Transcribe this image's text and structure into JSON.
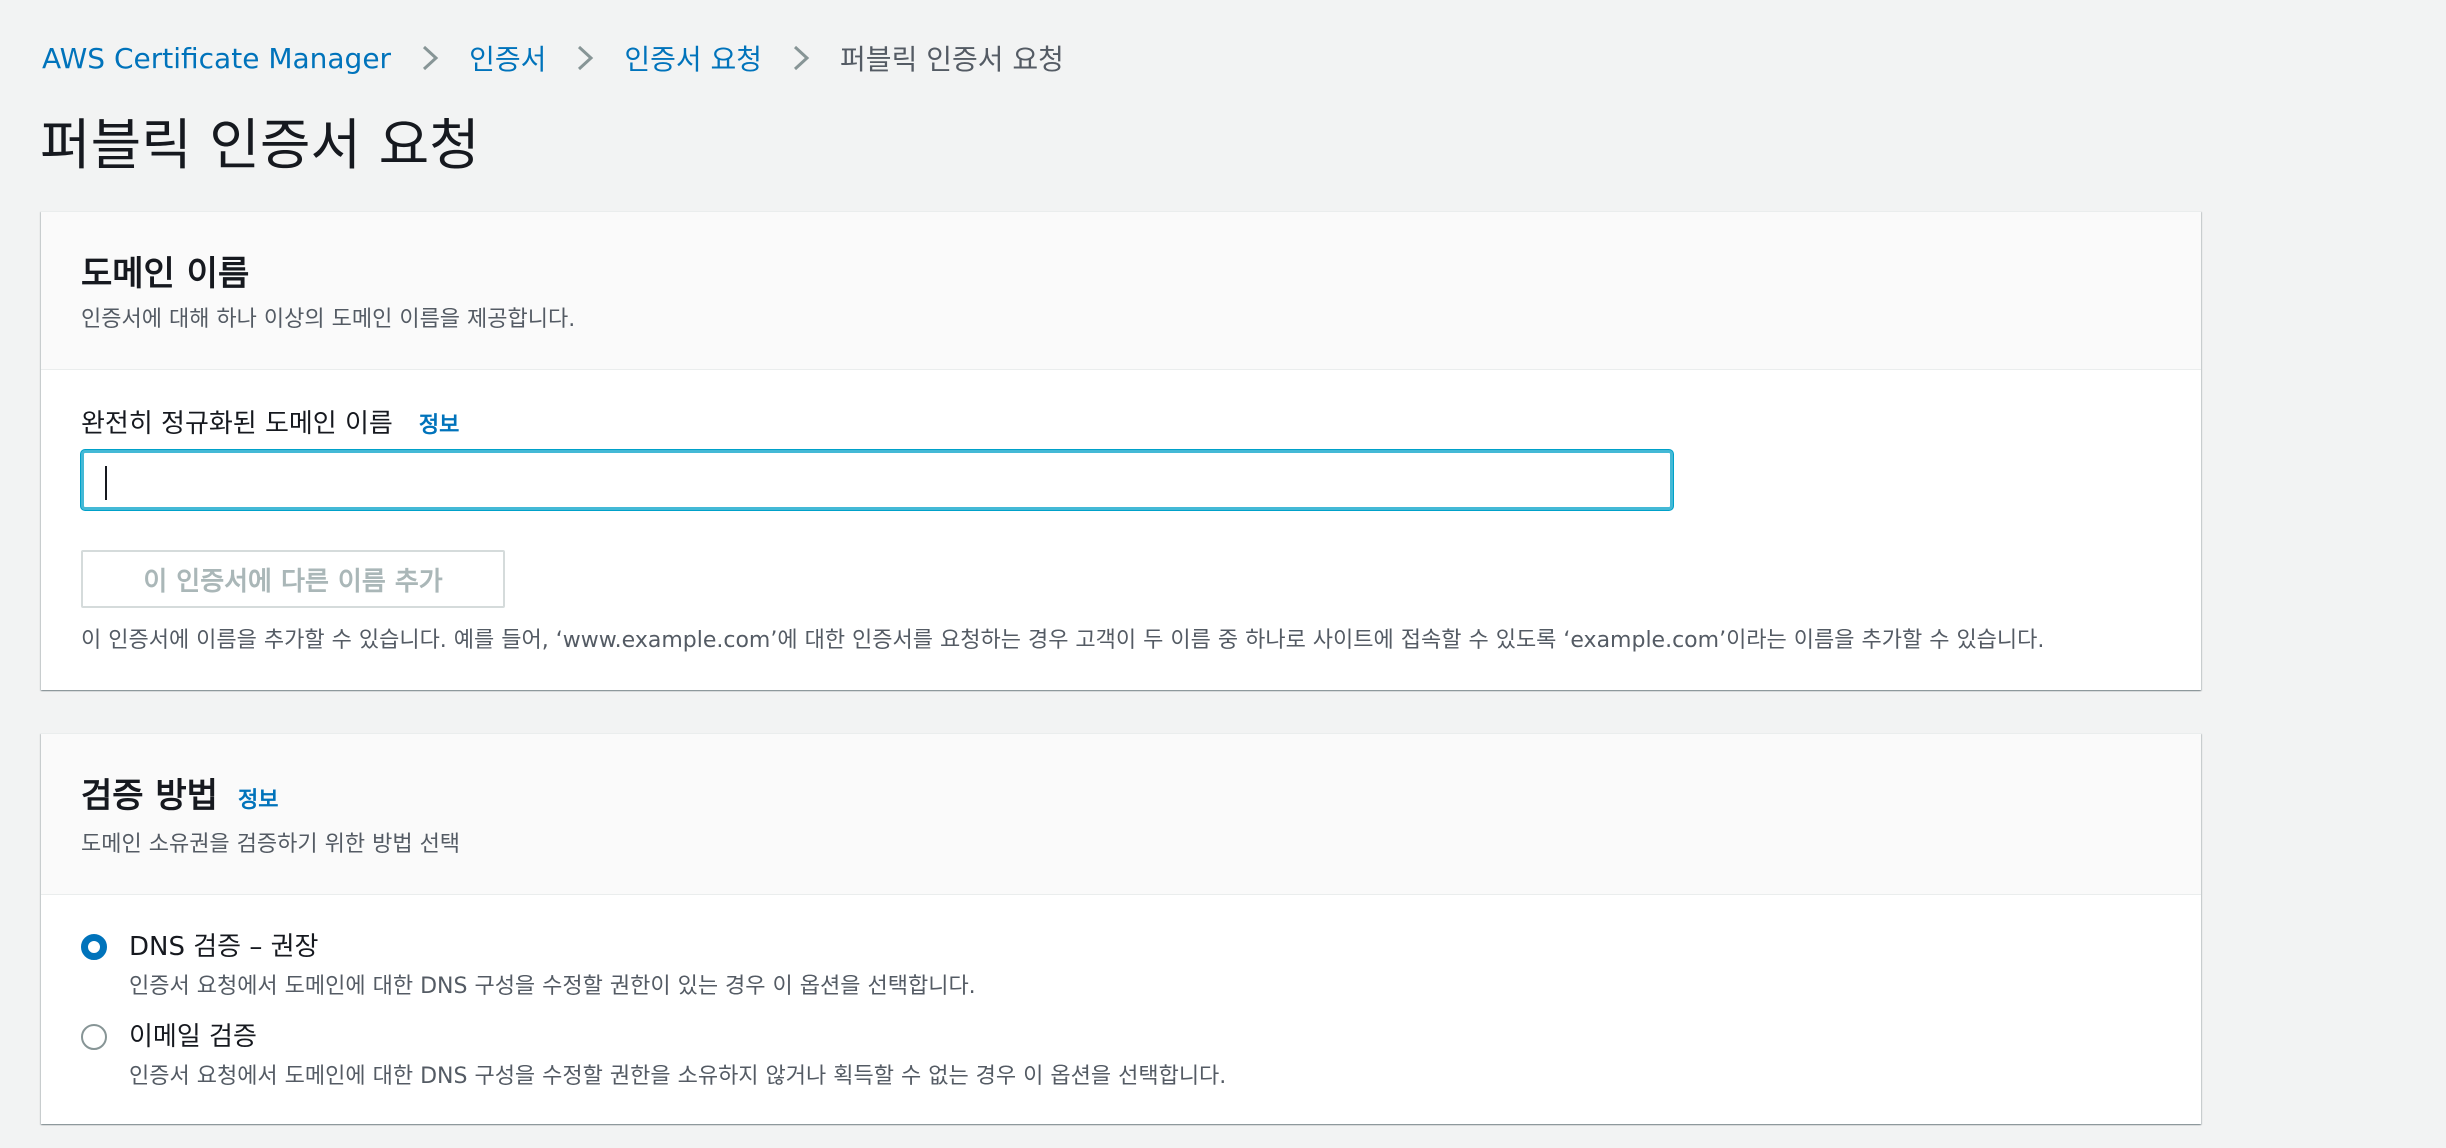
{
  "breadcrumb": {
    "items": [
      "AWS Certificate Manager",
      "인증서",
      "인증서 요청"
    ],
    "current": "퍼블릭 인증서 요청"
  },
  "page": {
    "title": "퍼블릭 인증서 요청"
  },
  "domain_section": {
    "title": "도메인 이름",
    "description": "인증서에 대해 하나 이상의 도메인 이름을 제공합니다.",
    "field_label": "완전히 정규화된 도메인 이름",
    "info_label": "정보",
    "input_value": "",
    "add_button_label": "이 인증서에 다른 이름 추가",
    "hint": "이 인증서에 이름을 추가할 수 있습니다. 예를 들어, ‘www.example.com’에 대한 인증서를 요청하는 경우 고객이 두 이름 중 하나로 사이트에 접속할 수 있도록 ‘example.com’이라는 이름을 추가할 수 있습니다."
  },
  "validation_section": {
    "title": "검증 방법",
    "info_label": "정보",
    "description": "도메인 소유권을 검증하기 위한 방법 선택",
    "options": [
      {
        "label": "DNS 검증 – 권장",
        "description": "인증서 요청에서 도메인에 대한 DNS 구성을 수정할 권한이 있는 경우 이 옵션을 선택합니다.",
        "selected": true
      },
      {
        "label": "이메일 검증",
        "description": "인증서 요청에서 도메인에 대한 DNS 구성을 수정할 권한을 소유하지 않거나 획득할 수 없는 경우 이 옵션을 선택합니다.",
        "selected": false
      }
    ]
  },
  "colors": {
    "link": "#0073bb",
    "focus": "#00a1c9",
    "radio_selected": "#0073bb"
  }
}
